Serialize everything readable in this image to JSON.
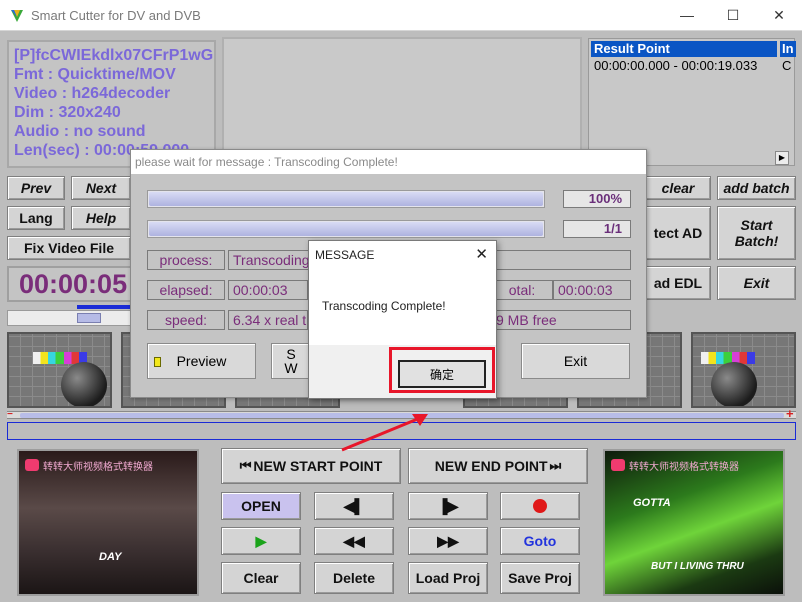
{
  "window": {
    "title": "Smart Cutter for DV and DVB",
    "min": "—",
    "max": "☐",
    "close": "✕"
  },
  "info": {
    "lines": [
      "[P]fcCWIEkdlx07CFrP1wG",
      "Fmt : Quicktime/MOV",
      "Video : h264decoder",
      "Dim : 320x240",
      "Audio : no sound",
      "Len(sec) : 00:00:59.000"
    ]
  },
  "result": {
    "col1": "Result Point",
    "col2": "In",
    "row1_col1": "00:00:00.000 - 00:00:19.033",
    "row1_col2": "C"
  },
  "left_buttons": {
    "prev": "Prev",
    "next": "Next",
    "lang": "Lang",
    "help": "Help",
    "fix": "Fix Video File"
  },
  "right_buttons": {
    "clear": "clear",
    "add_batch": "add batch",
    "detect": "tect AD",
    "start_batch": "Start\nBatch!",
    "load_edl": "ad EDL",
    "exit": "Exit"
  },
  "timecode": "00:00:05",
  "transport": {
    "new_start": "NEW START POINT",
    "new_end": "NEW END POINT",
    "open": "OPEN",
    "goto": "Goto",
    "clear": "Clear",
    "delete": "Delete",
    "load_proj": "Load Proj",
    "save_proj": "Save Proj"
  },
  "preview_left": {
    "watermark": "转转大师视频格式转换器",
    "caption": "DAY"
  },
  "preview_right": {
    "watermark": "转转大师视频格式转换器",
    "caption_top": "GOTTA",
    "caption_bottom": "BUT I LIVING THRU"
  },
  "progress_dialog": {
    "title": "please wait for message : Transcoding Complete!",
    "bar1_pct": "100%",
    "bar1_fraction": 1.0,
    "bar2_count": "1/1",
    "bar2_fraction": 1.0,
    "process_label": "process:",
    "process_value": "Transcoding",
    "elapsed_label": "elapsed:",
    "elapsed_value": "00:00:03",
    "total_label": "otal:",
    "total_value": "00:00:03",
    "speed_label": "speed:",
    "speed_value": "6.34 x real ti",
    "free_value": "9 MB free",
    "preview_btn": "Preview",
    "mid_btn_top": "S",
    "mid_btn_bottom": "W",
    "exit_btn": "Exit"
  },
  "message_box": {
    "title": "MESSAGE",
    "text": "Transcoding Complete!",
    "ok": "确定"
  }
}
